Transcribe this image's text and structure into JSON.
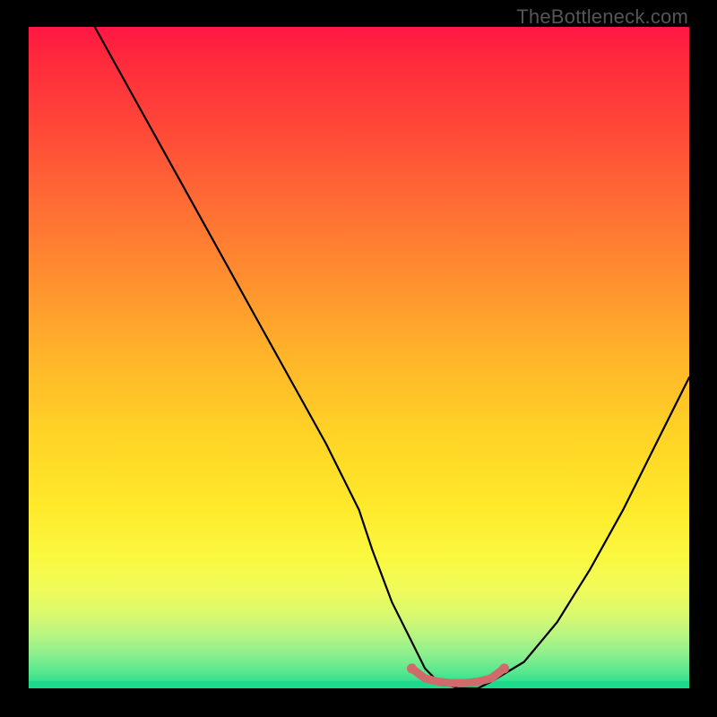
{
  "attribution": "TheBottleneck.com",
  "colors": {
    "frame": "#000000",
    "stroke": "#000000",
    "highlight": "#cf6b6a",
    "gradient_top": "#ff1744",
    "gradient_bottom": "#1cd98c"
  },
  "chart_data": {
    "type": "line",
    "title": "",
    "xlabel": "",
    "ylabel": "",
    "xlim": [
      0,
      100
    ],
    "ylim": [
      0,
      100
    ],
    "series": [
      {
        "name": "bottleneck-curve",
        "x": [
          10,
          15,
          20,
          25,
          30,
          35,
          40,
          45,
          50,
          52,
          55,
          58,
          60,
          62,
          65,
          68,
          70,
          75,
          80,
          85,
          90,
          95,
          100
        ],
        "y": [
          100,
          91,
          82,
          73,
          64,
          55,
          46,
          37,
          27,
          21,
          13,
          7,
          3,
          1,
          0,
          0,
          1,
          4,
          10,
          18,
          27,
          37,
          47
        ]
      },
      {
        "name": "optimal-flat-region",
        "x": [
          58,
          60,
          62,
          64,
          66,
          68,
          70,
          72
        ],
        "y": [
          3,
          1.5,
          1,
          0.8,
          0.8,
          1,
          1.5,
          3
        ]
      }
    ],
    "annotations": []
  }
}
